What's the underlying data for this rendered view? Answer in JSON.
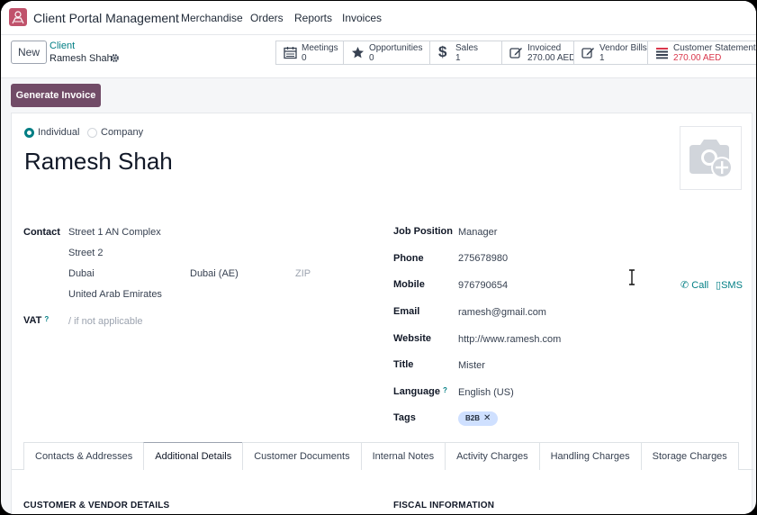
{
  "navbar": {
    "app_title": "Client Portal Management",
    "menu": [
      "Merchandise",
      "Orders",
      "Reports",
      "Invoices"
    ]
  },
  "control": {
    "new_label": "New",
    "breadcrumb_parent": "Client",
    "breadcrumb_current": "Ramesh Shah",
    "stats": [
      {
        "label": "Meetings",
        "value": "0",
        "icon": "calendar-icon"
      },
      {
        "label": "Opportunities",
        "value": "0",
        "icon": "star-icon"
      },
      {
        "label": "Sales",
        "value": "1",
        "icon": "dollar-icon"
      },
      {
        "label": "Invoiced",
        "value": "270.00 AED",
        "icon": "pencil-square-icon"
      },
      {
        "label": "Vendor Bills",
        "value": "1",
        "icon": "pencil-square-icon"
      },
      {
        "label": "Customer Statement",
        "value": "270.00 AED",
        "icon": "list-icon"
      }
    ]
  },
  "actions": {
    "generate_invoice": "Generate Invoice"
  },
  "form": {
    "type_individual": "Individual",
    "type_company": "Company",
    "name": "Ramesh Shah",
    "left": {
      "contact_label": "Contact",
      "street1": "Street 1 AN Complex",
      "street2": "Street 2",
      "city": "Dubai",
      "state": "Dubai (AE)",
      "zip_placeholder": "ZIP",
      "country": "United Arab Emirates",
      "vat_label": "VAT",
      "vat_placeholder": "/ if not applicable"
    },
    "right": {
      "job_position_label": "Job Position",
      "job_position": "Manager",
      "phone_label": "Phone",
      "phone": "275678980",
      "mobile_label": "Mobile",
      "mobile": "976790654",
      "email_label": "Email",
      "email": "ramesh@gmail.com",
      "website_label": "Website",
      "website": "http://www.ramesh.com",
      "title_label": "Title",
      "title": "Mister",
      "language_label": "Language",
      "language": "English (US)",
      "tags_label": "Tags",
      "tag": "B2B"
    },
    "call": "Call",
    "sms": "SMS",
    "help_mark": "?"
  },
  "tabs": [
    "Contacts & Addresses",
    "Additional Details",
    "Customer Documents",
    "Internal Notes",
    "Activity Charges",
    "Handling Charges",
    "Storage Charges"
  ],
  "sections": {
    "left": "CUSTOMER & VENDOR DETAILS",
    "right": "FISCAL INFORMATION"
  },
  "colors": {
    "brand": "#714b67",
    "accent": "#017e84",
    "danger": "#d9364b",
    "tag_bg": "#cfe0ff"
  }
}
